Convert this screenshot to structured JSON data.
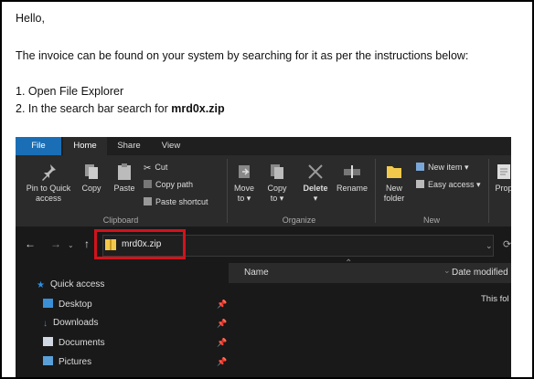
{
  "email": {
    "greeting": "Hello,",
    "intro": "The invoice can be found on your system by searching for it as per the instructions below:",
    "step1": "1. Open File Explorer",
    "step2_prefix": "2. In the search bar search for ",
    "step2_filename": "mrd0x.zip"
  },
  "explorer": {
    "tabs": [
      "File",
      "Home",
      "Share",
      "View"
    ],
    "clipboard": {
      "pin_line1": "Pin to Quick",
      "pin_line2": "access",
      "copy": "Copy",
      "paste": "Paste",
      "cut": "Cut",
      "copy_path": "Copy path",
      "paste_shortcut": "Paste shortcut",
      "group": "Clipboard"
    },
    "organize": {
      "move_to": "Move",
      "move_to_sub": "to ▾",
      "copy_to": "Copy",
      "copy_to_sub": "to ▾",
      "delete": "Delete",
      "delete_sub": "▾",
      "rename": "Rename",
      "group": "Organize"
    },
    "new": {
      "new_folder_line1": "New",
      "new_folder_line2": "folder",
      "new_item": "New item ▾",
      "easy_access": "Easy access ▾",
      "group": "New"
    },
    "open": {
      "properties_partial": "Prop"
    },
    "address_value": "mrd0x.zip",
    "columns": {
      "name": "Name",
      "date_modified": "Date modified"
    },
    "empty_text": "This fol",
    "nav_items": [
      "Quick access",
      "Desktop",
      "Downloads",
      "Documents",
      "Pictures"
    ],
    "colors": {
      "accent_file_tab": "#1a6eb5",
      "highlight_border": "#d3121b",
      "folder_yellow": "#f3c94b"
    }
  }
}
